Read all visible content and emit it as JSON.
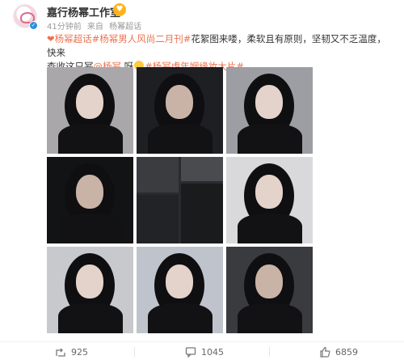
{
  "post": {
    "author": "嘉行杨幂工作室",
    "time": "41分钟前",
    "source_prefix": "来自",
    "source": "杨幂超话",
    "text": {
      "tag1": "杨幂超话",
      "tag2": "#杨幂男人风尚二月刊#",
      "line1_rest": "花絮图来喽，柔软且有原则，坚韧又不乏温度，快来",
      "line2_a": "查收这只幂",
      "mention": "@杨幂",
      "line2_b": " 呀",
      "tag3": "#杨幂虎年姻缘妆大片#"
    }
  },
  "photos": [
    {
      "bg": "#a9a7aa",
      "style": "light"
    },
    {
      "bg": "#1d1f22",
      "style": "dark"
    },
    {
      "bg": "#9c9ea3",
      "style": "mid"
    },
    {
      "bg": "#121315",
      "style": "dark"
    },
    {
      "bg": "#2a2b2e",
      "style": "collage"
    },
    {
      "bg": "#d9d9db",
      "style": "light"
    },
    {
      "bg": "#c8c9cc",
      "style": "mid"
    },
    {
      "bg": "#bfc4cc",
      "style": "light"
    },
    {
      "bg": "#3a3b3e",
      "style": "dark"
    }
  ],
  "actions": {
    "repost_count": "925",
    "comment_count": "1045",
    "like_count": "6859"
  },
  "colors": {
    "accent": "#eb7350",
    "verify": "#2a8fe0",
    "meta": "#999999"
  }
}
